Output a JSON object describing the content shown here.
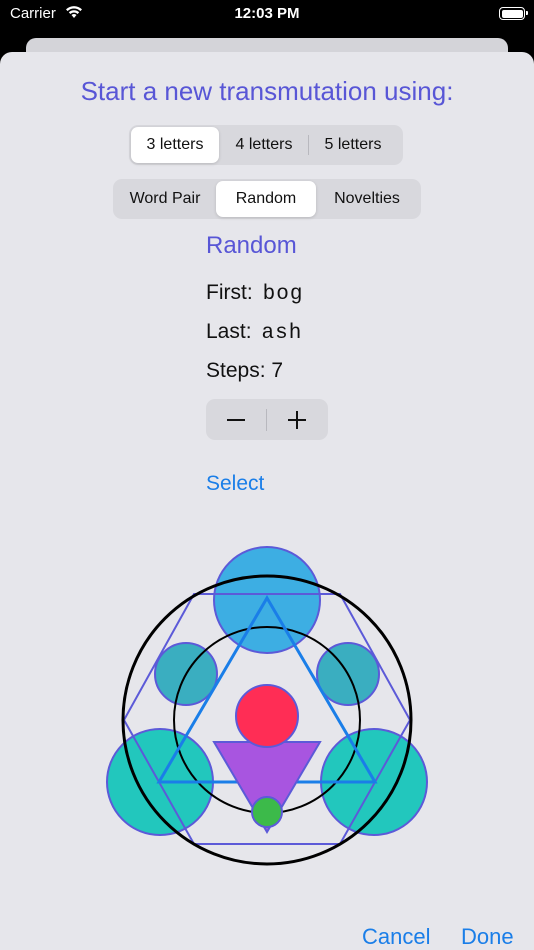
{
  "status_bar": {
    "carrier": "Carrier",
    "time": "12:03 PM"
  },
  "sheet": {
    "heading": "Start a new transmutation using:",
    "letter_options": [
      {
        "label": "3 letters",
        "selected": true
      },
      {
        "label": "4 letters",
        "selected": false
      },
      {
        "label": "5 letters",
        "selected": false
      }
    ],
    "mode_options": [
      {
        "label": "Word Pair",
        "selected": false
      },
      {
        "label": "Random",
        "selected": true
      },
      {
        "label": "Novelties",
        "selected": false
      }
    ],
    "mode_title": "Random",
    "first_label": "First:",
    "first_word": "bog",
    "last_label": "Last:",
    "last_word": "ash",
    "steps_label": "Steps:",
    "steps_value": "7",
    "select_label": "Select",
    "cancel_label": "Cancel",
    "done_label": "Done"
  },
  "colors": {
    "accent_purple": "#5856d6",
    "link_blue": "#1a7ee8",
    "circle_blue": "#3daee3",
    "circle_teal": "#3aaec0",
    "circle_cyan": "#22c7bd",
    "triangle_purple": "#a855e0",
    "center_red": "#ff2d55",
    "bottom_green": "#3cba4a"
  }
}
